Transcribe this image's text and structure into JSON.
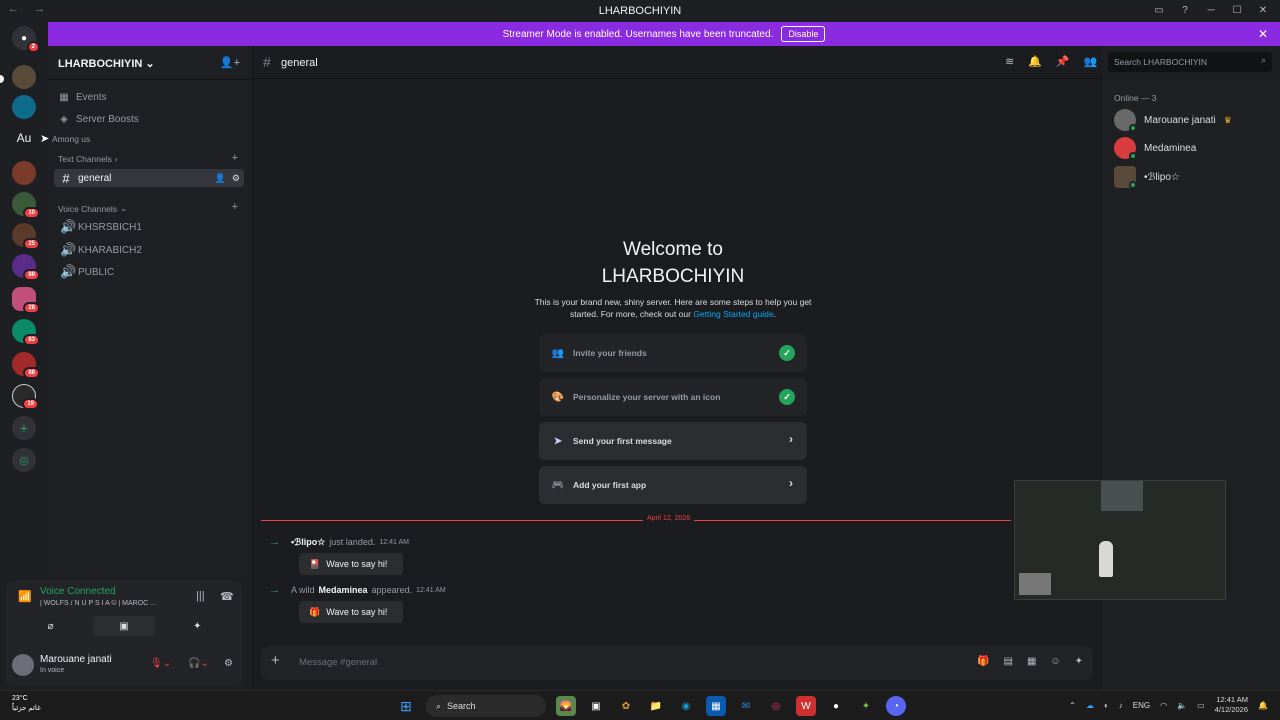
{
  "window": {
    "title": "LHARBOCHIYIN"
  },
  "streamer_bar": {
    "text": "Streamer Mode is enabled. Usernames have been truncated.",
    "button": "Disable"
  },
  "server_rail": {
    "home_badge": "2",
    "badges": [
      "10",
      "25",
      "88",
      "28",
      "83",
      "88",
      "19"
    ],
    "tooltip_prefix": "Au",
    "tooltip": "Among us"
  },
  "sidebar": {
    "server_name": "LHARBOCHIYIN",
    "events": "Events",
    "boosts": "Server Boosts",
    "text_category": "Text Channels",
    "text_channels": [
      "general"
    ],
    "voice_category": "Voice Channels",
    "voice_channels": [
      "KHSRSBICH1",
      "KHARABICH2",
      "PUBLIC"
    ]
  },
  "voice_panel": {
    "status": "Voice Connected",
    "channel": "| WOLFS / N U P S I A © | MAROC ..."
  },
  "user": {
    "name": "Marouane janati",
    "status": "In voice"
  },
  "channel_header": {
    "name": "general",
    "search_placeholder": "Search LHARBOCHIYIN"
  },
  "welcome": {
    "title_line1": "Welcome to",
    "title_line2": "LHARBOCHIYIN",
    "subtitle": "This is your brand new, shiny server. Here are some steps to help you get started. For more, check out our ",
    "link": "Getting Started guide",
    "steps": [
      {
        "label": "Invite your friends",
        "done": true
      },
      {
        "label": "Personalize your server with an icon",
        "done": true
      },
      {
        "label": "Send your first message",
        "done": false
      },
      {
        "label": "Add your first app",
        "done": false
      }
    ]
  },
  "messages": {
    "date_divider": "April 12, 2026",
    "m1_user": "•ℬlipo☆",
    "m1_text": "just landed.",
    "m1_time": "12:41 AM",
    "m2_prefix": "A wild",
    "m2_user": "Medaminea",
    "m2_text": "appeared.",
    "m2_time": "12:41 AM",
    "wave": "Wave to say hi!"
  },
  "composer": {
    "placeholder": "Message #general"
  },
  "members": {
    "header": "Online — 3",
    "list": [
      "Marouane janati",
      "Medaminea",
      "•ℬlipo☆"
    ]
  },
  "taskbar": {
    "temp": "23°C",
    "weather_text": "غائم جزئياً",
    "search": "Search",
    "lang": "ENG",
    "time": "12:41 AM",
    "date": "4/12/2026"
  },
  "colors": {
    "accent": "#8a2be2",
    "online": "#23a55a",
    "danger": "#f23f43",
    "link": "#00a8fc"
  }
}
